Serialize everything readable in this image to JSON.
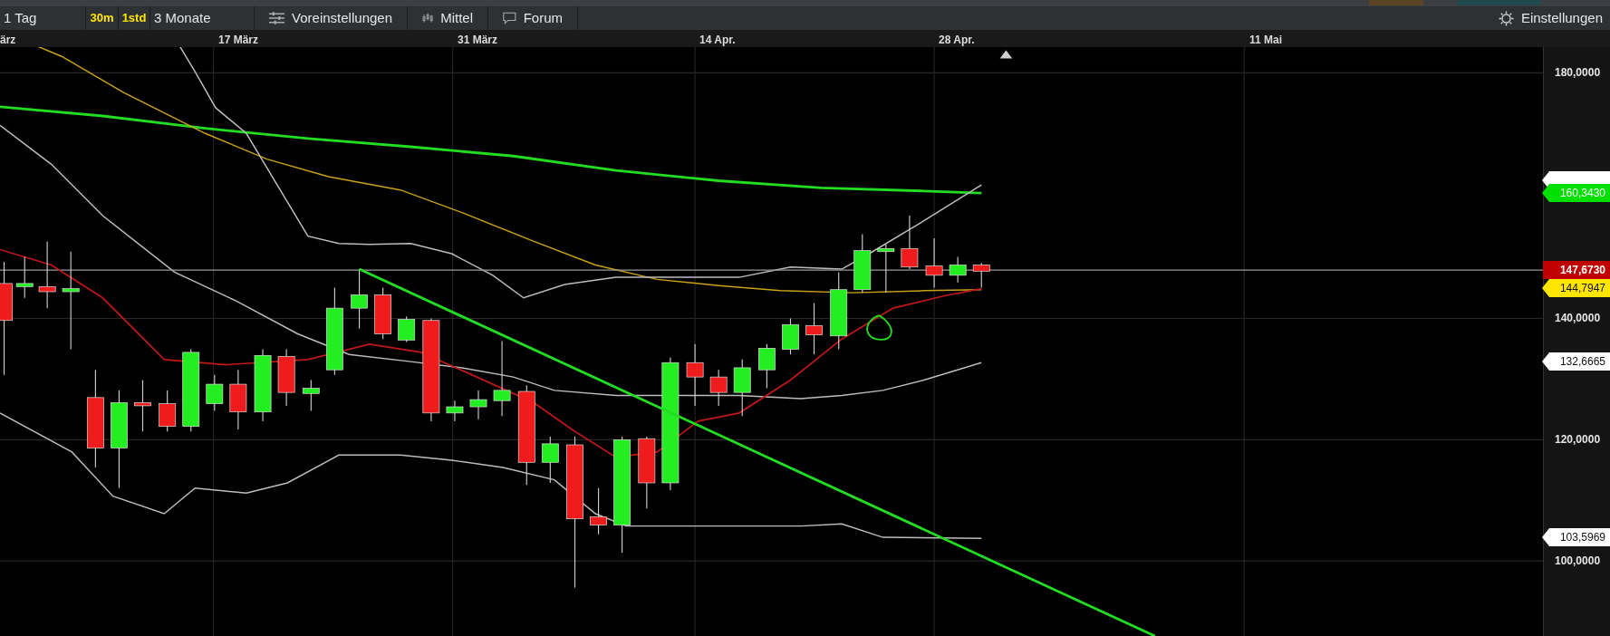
{
  "toolbar": {
    "items": [
      {
        "label": "1 Tag",
        "kind": "plain"
      },
      {
        "label": "30m",
        "kind": "highlight"
      },
      {
        "label": "1std",
        "kind": "highlight"
      },
      {
        "label": "3 Monate",
        "kind": "plain"
      },
      {
        "label": "Voreinstellungen",
        "kind": "sliders"
      },
      {
        "label": "Mittel",
        "kind": "candles"
      },
      {
        "label": "Forum",
        "kind": "chat"
      }
    ],
    "settings": "Einstellungen"
  },
  "chart": {
    "date_labels": [
      "ärz",
      "17 März",
      "31 März",
      "14 Apr.",
      "28 Apr.",
      "11 Mai"
    ],
    "price_ticks": [
      "180,0000",
      "140,0000",
      "120,0000",
      "100,0000"
    ],
    "price_tags": [
      {
        "value": "160,3430",
        "kind": "arrow",
        "color": "#00e000"
      },
      {
        "value": "147,6730",
        "kind": "box",
        "color": "#c00000"
      },
      {
        "value": "144,7947",
        "kind": "arrow",
        "color": "#ffe600"
      },
      {
        "value": "132,6665",
        "kind": "arrow",
        "color": "#ffffff"
      },
      {
        "value": "103,5969",
        "kind": "arrow",
        "color": "#ffffff"
      }
    ]
  }
}
